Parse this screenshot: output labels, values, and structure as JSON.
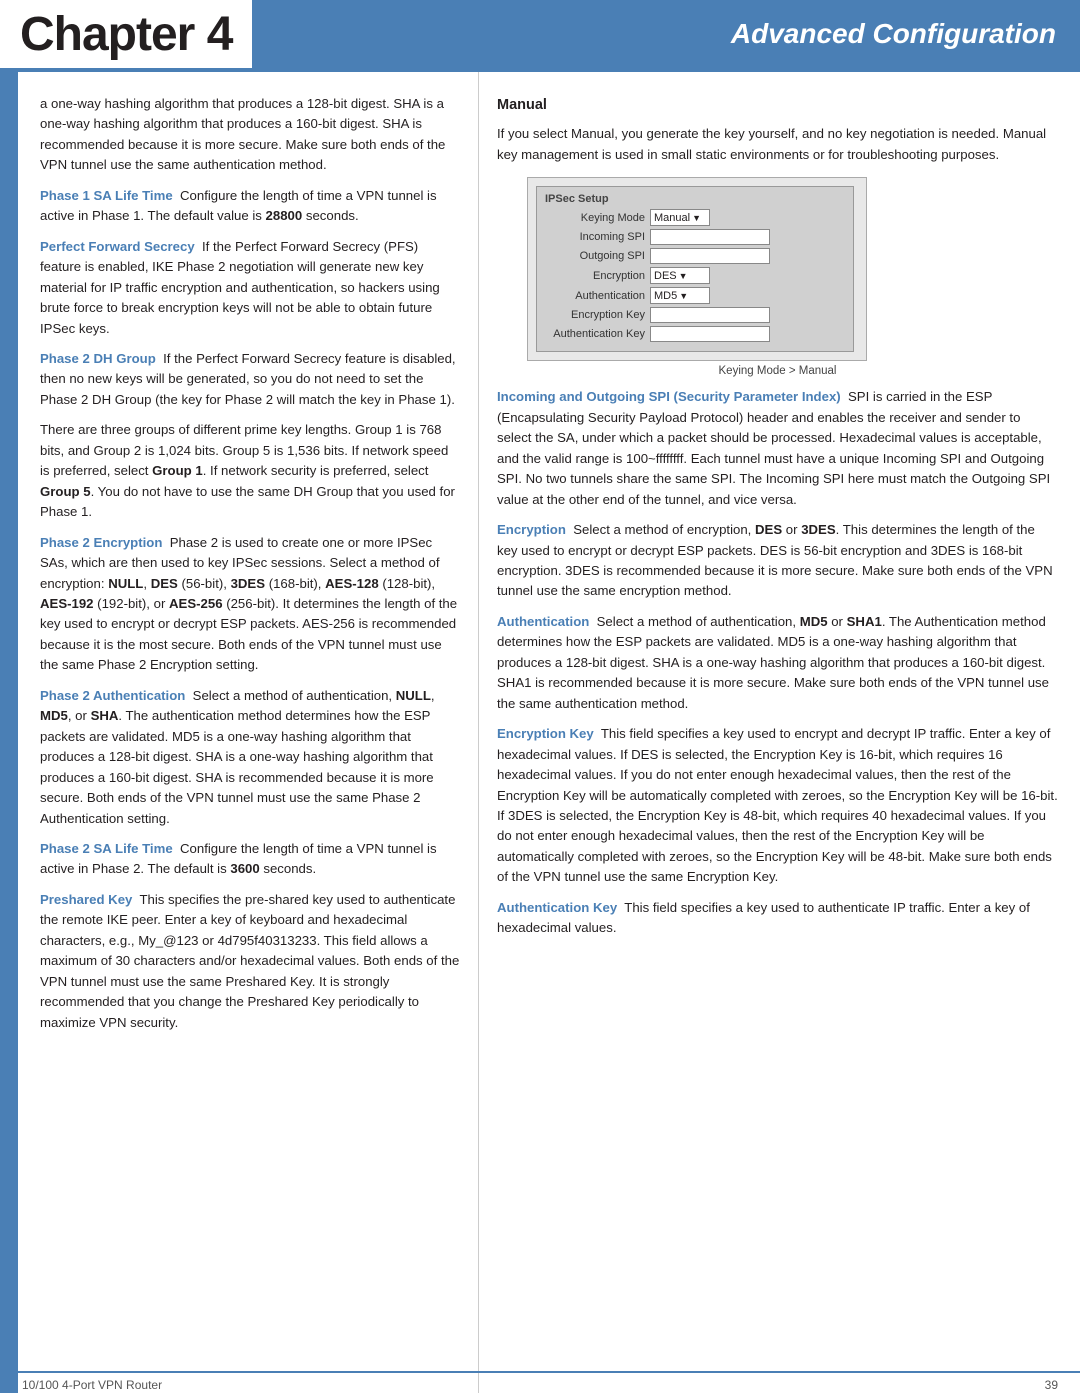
{
  "header": {
    "chapter": "Chapter 4",
    "subtitle": "Advanced Configuration"
  },
  "footer": {
    "left": "10/100 4-Port VPN Router",
    "right": "39"
  },
  "left_column": {
    "intro_paragraph": "a one-way hashing algorithm that produces a 128-bit digest. SHA is a one-way hashing algorithm that produces a 160-bit digest. SHA is recommended because it is more secure. Make sure both ends of the VPN tunnel use the same authentication method.",
    "terms": [
      {
        "term": "Phase 1 SA Life Time",
        "definition": "Configure the length of time a VPN tunnel is active in Phase 1. The default value is",
        "bold_value": "28800",
        "definition_suffix": "seconds."
      },
      {
        "term": "Perfect Forward Secrecy",
        "definition": "If the Perfect Forward Secrecy (PFS) feature is enabled, IKE Phase 2 negotiation will generate new key material for IP traffic encryption and authentication, so hackers using brute force to break encryption keys will not be able to obtain future IPSec keys."
      },
      {
        "term": "Phase 2 DH Group",
        "definition": "If the Perfect Forward Secrecy feature is disabled, then no new keys will be generated, so you do not need to set the Phase 2 DH Group (the key for Phase 2 will match the key in Phase 1).",
        "extra": "There are three groups of different prime key lengths. Group 1 is 768 bits, and Group 2 is 1,024 bits. Group 5 is 1,536 bits. If network speed is preferred, select",
        "bold1": "Group 1",
        "extra2": ". If network security is preferred, select",
        "bold2": "Group 5",
        "extra3": ". You do not have to use the same DH Group that you used for Phase 1."
      },
      {
        "term": "Phase 2 Encryption",
        "definition": "Phase 2 is used to create one or more IPSec SAs, which are then used to key IPSec sessions. Select a method of encryption:",
        "bold_items": [
          "NULL",
          "DES",
          "3DES",
          "AES-128",
          "AES-192",
          "AES-256"
        ],
        "definition2": "(168-bit),",
        "definition3": "(128-bit),",
        "definition4": "(192-bit), or",
        "definition5": "(256-bit). It determines the length of the key used to encrypt or decrypt ESP packets. AES-256 is recommended because it is the most secure. Both ends of the VPN tunnel must use the same Phase 2 Encryption setting."
      },
      {
        "term": "Phase 2 Authentication",
        "definition": "Select a method of authentication,",
        "bold_items2": [
          "NULL",
          "MD5",
          "SHA"
        ],
        "definition2": ". The authentication method determines how the ESP packets are validated. MD5 is a one-way hashing algorithm that produces a 128-bit digest. SHA is a one-way hashing algorithm that produces a 160-bit digest. SHA is recommended because it is more secure. Both ends of the VPN tunnel must use the same Phase 2 Authentication setting."
      },
      {
        "term": "Phase 2 SA Life Time",
        "definition": "Configure the length of time a VPN tunnel is active in Phase 2. The default is",
        "bold_value": "3600",
        "definition_suffix": "seconds."
      },
      {
        "term": "Preshared Key",
        "definition": "This specifies the pre-shared key used to authenticate the remote IKE peer. Enter a key of keyboard and hexadecimal characters, e.g., My_@123 or 4d795f40313233. This field allows a maximum of 30 characters and/or hexadecimal values. Both ends of the VPN tunnel must use the same Preshared Key. It is strongly recommended that you change the Preshared Key periodically to maximize VPN security."
      }
    ]
  },
  "right_column": {
    "manual_heading": "Manual",
    "manual_intro": "If you select Manual, you generate the key yourself, and no key negotiation is needed. Manual key management is used in small static environments or for troubleshooting purposes.",
    "ipsec_setup": {
      "title": "IPSec Setup",
      "keying_mode_label": "Keying Mode",
      "keying_mode_value": "Manual",
      "incoming_spi_label": "Incoming SPI",
      "outgoing_spi_label": "Outgoing SPI",
      "encryption_label": "Encryption",
      "encryption_value": "DES",
      "authentication_label": "Authentication",
      "authentication_value": "MD5",
      "encryption_key_label": "Encryption Key",
      "authentication_key_label": "Authentication Key"
    },
    "ipsec_caption": "Keying Mode > Manual",
    "terms": [
      {
        "term": "Incoming and Outgoing SPI (Security Parameter Index)",
        "definition": "SPI is carried in the ESP (Encapsulating Security Payload Protocol) header and enables the receiver and sender to select the SA, under which a packet should be processed. Hexadecimal values is acceptable, and the valid range is 100~ffffffff. Each tunnel must have a unique Incoming SPI and Outgoing SPI. No two tunnels share the same SPI. The Incoming SPI here must match the Outgoing SPI value at the other end of the tunnel, and vice versa."
      },
      {
        "term": "Encryption",
        "definition": "Select a method of encryption,",
        "bold1": "DES",
        "mid": "or",
        "bold2": "3DES",
        "definition2": ". This determines the length of the key used to encrypt or decrypt ESP packets. DES is 56-bit encryption and 3DES is 168-bit encryption. 3DES is recommended because it is more secure. Make sure both ends of the VPN tunnel use the same encryption method."
      },
      {
        "term": "Authentication",
        "definition": "Select a method of authentication,",
        "bold1": "MD5",
        "mid": "or",
        "bold2": "SHA1",
        "definition2": ". The Authentication method determines how the ESP packets are validated. MD5 is a one-way hashing algorithm that produces a 128-bit digest. SHA is a one-way hashing algorithm that produces a 160-bit digest. SHA1 is recommended because it is more secure. Make sure both ends of the VPN tunnel use the same authentication method."
      },
      {
        "term": "Encryption Key",
        "definition": "This field specifies a key used to encrypt and decrypt IP traffic. Enter a key of hexadecimal values. If DES is selected, the Encryption Key is 16-bit, which requires 16 hexadecimal values. If you do not enter enough hexadecimal values, then the rest of the Encryption Key will be automatically completed with zeroes, so the Encryption Key will be 16-bit. If 3DES is selected, the Encryption Key is 48-bit, which requires 40 hexadecimal values. If you do not enter enough hexadecimal values, then the rest of the Encryption Key will be automatically completed with zeroes, so the Encryption Key will be 48-bit. Make sure both ends of the VPN tunnel use the same Encryption Key."
      },
      {
        "term": "Authentication Key",
        "definition": "This field specifies a key used to authenticate IP traffic. Enter a key of hexadecimal values."
      }
    ]
  }
}
